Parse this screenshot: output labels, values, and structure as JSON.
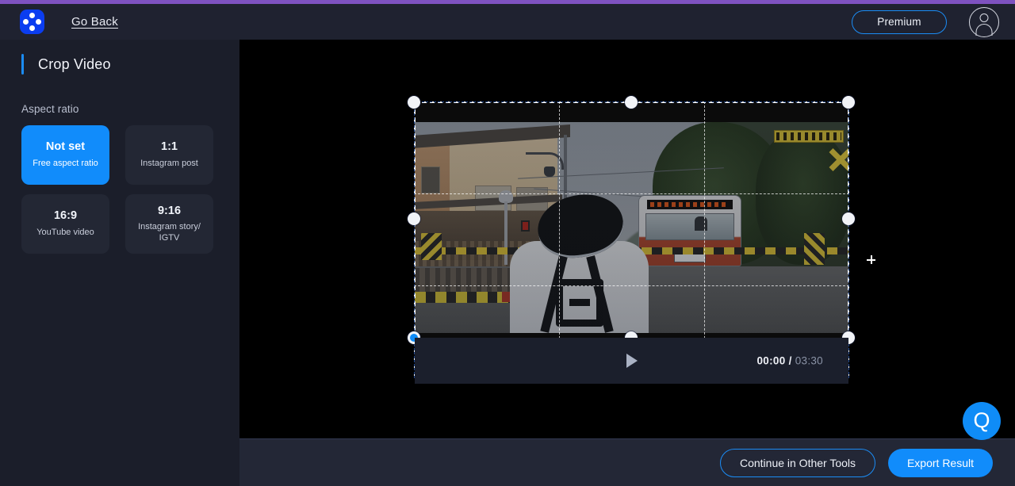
{
  "header": {
    "logo_icon": "app-logo-icon",
    "go_back_label": "Go Back",
    "premium_label": "Premium",
    "avatar_icon": "user-avatar-icon"
  },
  "sidebar": {
    "panel_title": "Crop Video",
    "section_label": "Aspect ratio",
    "ratios": [
      {
        "title": "Not set",
        "subtitle": "Free aspect ratio",
        "selected": true
      },
      {
        "title": "1:1",
        "subtitle": "Instagram post",
        "selected": false
      },
      {
        "title": "16:9",
        "subtitle": "YouTube video",
        "selected": false
      },
      {
        "title": "9:16",
        "subtitle": "Instagram story/ IGTV",
        "selected": false
      }
    ]
  },
  "player": {
    "play_icon": "play-icon",
    "current_time": "00:00",
    "separator": "/",
    "total_time": "03:30"
  },
  "crop": {
    "handles": [
      "top-left",
      "top-center",
      "top-right",
      "middle-left",
      "middle-right",
      "bottom-left",
      "bottom-center",
      "bottom-right"
    ],
    "active_handle": "bottom-left",
    "cursor_icon": "move-crosshair-icon"
  },
  "footer": {
    "continue_label": "Continue in Other Tools",
    "export_label": "Export Result"
  },
  "help": {
    "glyph": "Q"
  },
  "colors": {
    "accent_blue": "#118cfb",
    "outline_blue": "#1b8cf5",
    "loader_purple": "#7e52c0",
    "sidebar_bg": "#1b1e2a",
    "header_bg": "#1f2230",
    "footer_bg": "#232736",
    "canvas_bg": "#000000",
    "card_bg": "#232734"
  }
}
